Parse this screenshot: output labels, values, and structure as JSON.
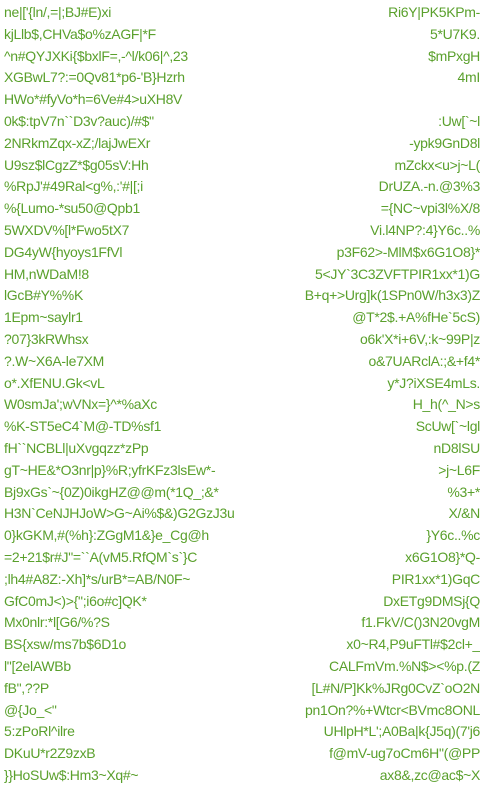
{
  "accent_color": "#5aa02c",
  "left_lines": [
    "ne|['{ln/,=|;BJ#E)xi",
    "kjLlb$,CHVa$o%zAGF|*F",
    "^n#QYJXKi{$bxlF=,-^l/k06|^,23",
    "XGBwL7?:=0Qv81*p6-'B}Hzrh",
    "HWo*#fyVo*h=6Ve#4>uXH8V",
    "0k$:tpV7n``D3v?auc)/#$\"",
    "2NRkmZqx-xZ;/lajJwEXr",
    "U9sz$lCgzZ*$g05sV:Hh",
    "%RpJ'#49Ral<g%,:'#|[;i",
    "%{Lumo-*su50@Qpb1",
    "5WXDV%[l*Fwo5tX7",
    "DG4yW{hyoys1FfVl",
    "HM,nWDaM!8",
    "lGcB#Y%%K",
    "1Epm~saylr1",
    "?07}3kRWhsx",
    "?.W~X6A-le7XM",
    "o*.XfENU.Gk<vL",
    "W0smJa';wVNx=}^*%aXc",
    "%K-ST5eC4`M@-TD%sf1",
    "fH``NCBLl|uXvgqzz*zPp",
    "gT~HE&*O3nr|p}%R;yfrKFz3lsEw*-",
    "Bj9xGs`~{0Z)0ikgHZ@@m(*1Q_;&*",
    "H3N`CeNJHJoW>G~Ai%$&)G2GzJ3u",
    "0}kGKM,#(%h}:ZGgM1&}e_Cg@h",
    "=2+21$r#J\"=``A(vM5.RfQM`s`}C",
    ";lh4#A8Z:-Xh]*s/urB*=AB/N0F~",
    "GfC0mJ<)>{\";i6o#c]QK*",
    "Mx0nlr:*l[G6/%?S",
    "BS{xsw/ms7b$6D1o",
    "l\"[2elAWBb",
    "fB\",??P",
    "@{Jo_<\"",
    "5:zPoRl^ilre",
    "DKuU*r2Z9zxB",
    "}}HoSUw$:Hm3~Xq#~"
  ],
  "right_lines": [
    "Ri6Y|PK5KPm-",
    "5*U7K9.",
    "$mPxgH",
    "4mI",
    "",
    ":Uw[`~l",
    "-ypk9GnD8l",
    "mZckx<u>j~L(",
    "DrUZA.-n.@3%3",
    "={NC~vpi3l%X/8",
    "Vi.l4NP?:4}Y6c..%",
    "p3F62>-MlM$x6G1O8}*",
    "5<JY`3C3ZVFTPIR1xx*1)G",
    "B+q+>Urg]k(1SPn0W/h3x3)Z",
    "@T*2$.+A%fHe`5cS)",
    "o6k'X*i+6V,:k~99P|z",
    "o&7UARclA:;&+f4*",
    "y*J?iXSE4mLs.",
    "H_h(^_N>s",
    "ScUw[`~lgl",
    "nD8lSU",
    ">j~L6F",
    "%3+*",
    "X/&N",
    "}Y6c..%c",
    "x6G1O8}*Q-",
    "PIR1xx*1)GqC",
    "DxETg9DMSj{Q",
    "f1.FkV/C()3N20vgM",
    "x0~R4,P9uFTl#$2cl+_",
    "CALFmVm.%N$><%p.(Z",
    "[L#N/P]Kk%JRg0CvZ`oO2N",
    "pn1On?%+Wtcr<BVmc8ONL",
    "UHlpH*L';A0Ba|k{J5q)(7'j6",
    "f@mV-ug7oCm6H\"(@PP",
    "ax8&,zc@ac$~X"
  ]
}
